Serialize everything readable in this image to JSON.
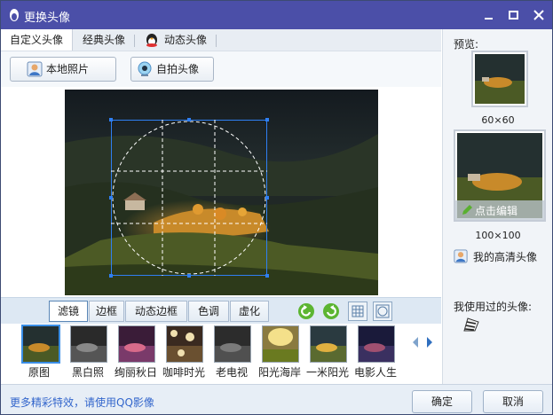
{
  "window": {
    "title": "更换头像"
  },
  "tabs": [
    "自定义头像",
    "经典头像",
    "动态头像"
  ],
  "buttons": {
    "local_photo": "本地照片",
    "webcam": "自拍头像"
  },
  "filter_tabs": [
    "滤镜",
    "边框",
    "动态边框",
    "色调",
    "虚化"
  ],
  "filters": [
    "原图",
    "黑白照",
    "绚丽秋日",
    "咖啡时光",
    "老电视",
    "阳光海岸",
    "一米阳光",
    "电影人生"
  ],
  "preview": {
    "label": "预览:",
    "size_small": "60×60",
    "size_large": "100×100",
    "edit_hint": "点击编辑",
    "hd_avatar": "我的高清头像",
    "used_label": "我使用过的头像:"
  },
  "footer": {
    "more_link": "更多精彩特效，请使用QQ影像",
    "ok": "确定",
    "cancel": "取消"
  },
  "colors": {
    "titlebar": "#4b4fa8",
    "accent": "#2f7ff2",
    "link": "#3366cc"
  },
  "icons": [
    "qq-penguin-icon",
    "minimize-icon",
    "maximize-icon",
    "close-icon",
    "photo-user-icon",
    "webcam-icon",
    "undo-icon",
    "redo-icon",
    "grid-icon",
    "circle-icon",
    "scroll-left-icon",
    "scroll-right-icon",
    "zebra-icon"
  ]
}
